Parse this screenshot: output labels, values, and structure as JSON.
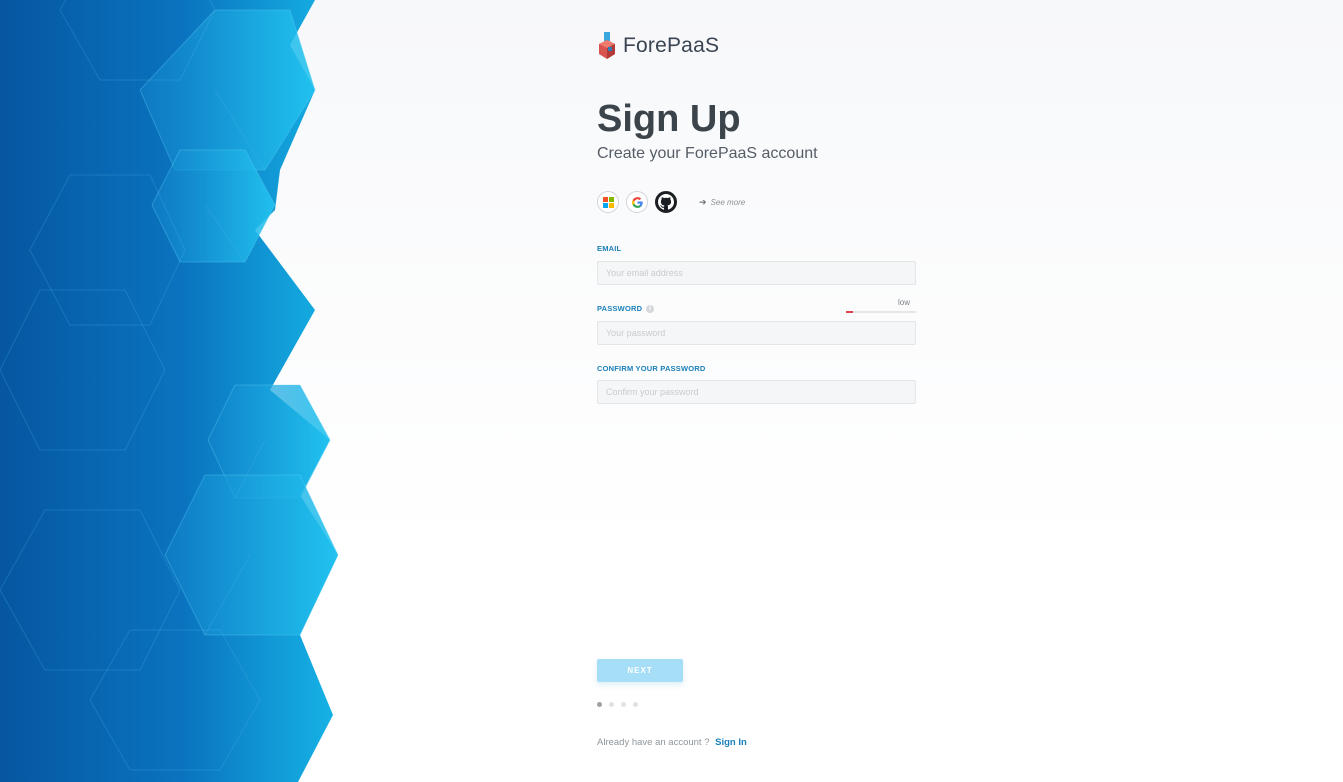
{
  "brand": {
    "name": "ForePaaS",
    "logo_icon": "forepaas-logo-icon"
  },
  "heading": {
    "title": "Sign Up",
    "subtitle": "Create your ForePaaS account"
  },
  "providers": [
    {
      "name": "microsoft",
      "icon": "microsoft-icon"
    },
    {
      "name": "google",
      "icon": "google-icon"
    },
    {
      "name": "github",
      "icon": "github-icon"
    }
  ],
  "see_more": {
    "label": "See more",
    "icon": "arrow-right-icon"
  },
  "form": {
    "email": {
      "label": "EMAIL",
      "placeholder": "Your email address",
      "value": ""
    },
    "password": {
      "label": "PASSWORD",
      "placeholder": "Your password",
      "value": "",
      "info_icon": "info-icon"
    },
    "password_strength": {
      "label": "low",
      "level": 0.1,
      "color": "#e0424b"
    },
    "confirm_password": {
      "label": "CONFIRM YOUR PASSWORD",
      "placeholder": "Confirm your password",
      "value": ""
    }
  },
  "next_button": {
    "label": "NEXT"
  },
  "steps": {
    "total": 4,
    "current": 1
  },
  "footer": {
    "text": "Already have an account ?",
    "link_label": "Sign In"
  },
  "colors": {
    "accent": "#1a7fb9",
    "button": "#a5def6",
    "hex_dark": "#0a5ea8",
    "hex_light": "#1ab8e8"
  }
}
